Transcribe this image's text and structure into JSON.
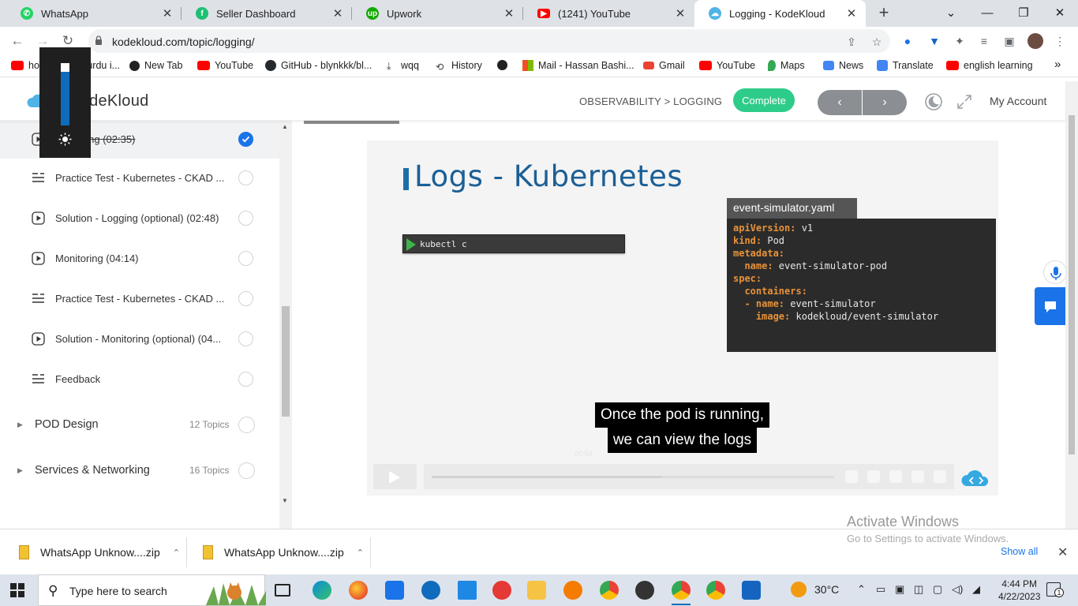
{
  "browser": {
    "tabs": [
      {
        "label": "WhatsApp",
        "icon": "whatsapp-icon",
        "color": "#25d366",
        "active": false
      },
      {
        "label": "Seller Dashboard",
        "icon": "fiverr-icon",
        "color": "#1dbf73",
        "active": false
      },
      {
        "label": "Upwork",
        "icon": "upwork-icon",
        "color": "#14a800",
        "active": false
      },
      {
        "label": "(1241) YouTube",
        "icon": "youtube-icon",
        "color": "#ff0000",
        "active": false
      },
      {
        "label": "Logging - KodeKloud",
        "icon": "kodekloud-icon",
        "color": "#4fb3e8",
        "active": true
      }
    ],
    "url": "kodekloud.com/topic/logging/",
    "bookmarks": [
      {
        "label": "how to make urdu i...",
        "color": "#ff0000"
      },
      {
        "label": "New Tab",
        "color": "#222222"
      },
      {
        "label": "YouTube",
        "color": "#ff0000"
      },
      {
        "label": "GitHub - blynkkk/bl...",
        "color": "#24292e"
      },
      {
        "label": "wqq",
        "color": "#444444"
      },
      {
        "label": "History",
        "color": "#444444"
      },
      {
        "label": "",
        "color": "#222222"
      },
      {
        "label": "Mail - Hassan Bashi...",
        "color": "#f25022"
      },
      {
        "label": "Gmail",
        "color": "#ea4335"
      },
      {
        "label": "YouTube",
        "color": "#ff0000"
      },
      {
        "label": "Maps",
        "color": "#34a853"
      },
      {
        "label": "News",
        "color": "#4285f4"
      },
      {
        "label": "Translate",
        "color": "#4285f4"
      },
      {
        "label": "english learning",
        "color": "#ff0000"
      }
    ],
    "more_bookmarks": "»"
  },
  "kk": {
    "logo_text": "KodeKloud",
    "breadcrumb": "OBSERVABILITY > LOGGING",
    "complete_label": "Complete",
    "prev": "‹",
    "next": "›",
    "account_label": "My Account",
    "accent": "#2ecc8a"
  },
  "sidebar": {
    "lessons": [
      {
        "label": "Logging (02:35)",
        "visible_label": "ging (02:35)",
        "icon": "play-circle-icon",
        "done": true,
        "current": true
      },
      {
        "label": "Practice Test - Kubernetes - CKAD ...",
        "icon": "list-icon",
        "done": false
      },
      {
        "label": "Solution - Logging (optional) (02:48)",
        "icon": "play-circle-icon",
        "done": false
      },
      {
        "label": "Monitoring (04:14)",
        "icon": "play-circle-icon",
        "done": false
      },
      {
        "label": "Practice Test - Kubernetes - CKAD ...",
        "icon": "list-icon",
        "done": false
      },
      {
        "label": "Solution - Monitoring (optional) (04...",
        "icon": "play-circle-icon",
        "done": false
      },
      {
        "label": "Feedback",
        "icon": "list-icon",
        "done": false
      }
    ],
    "sections": [
      {
        "title": "POD Design",
        "count": "12 Topics"
      },
      {
        "title": "Services & Networking",
        "count": "16 Topics"
      }
    ]
  },
  "video": {
    "slide_title": "Logs - Kubernetes",
    "terminal_command": "kubectl c",
    "yaml_filename": "event-simulator.yaml",
    "yaml_lines": [
      {
        "indent": "",
        "key": "apiVersion:",
        "value": " v1"
      },
      {
        "indent": "",
        "key": "kind:",
        "value": " Pod"
      },
      {
        "indent": "",
        "key": "metadata:",
        "value": ""
      },
      {
        "indent": "  ",
        "key": "name:",
        "value": " event-simulator-pod"
      },
      {
        "indent": "",
        "key": "spec:",
        "value": ""
      },
      {
        "indent": "  ",
        "key": "containers:",
        "value": ""
      },
      {
        "indent": "  - ",
        "key": "name:",
        "value": " event-simulator"
      },
      {
        "indent": "    ",
        "key": "image:",
        "value": " kodekloud/event-simulator"
      }
    ],
    "caption_lines": [
      "Once the pod is running,",
      "we can view the logs"
    ],
    "time": "00:54",
    "progress": 0.57
  },
  "watermark": {
    "line1": "Activate Windows",
    "line2": "Go to Settings to activate Windows."
  },
  "downloads": {
    "items": [
      {
        "name": "WhatsApp Unknow....zip"
      },
      {
        "name": "WhatsApp Unknow....zip"
      }
    ],
    "show_all": "Show all",
    "close": "✕"
  },
  "taskbar": {
    "search_placeholder": "Type here to search",
    "temperature": "30°C",
    "time": "4:44 PM",
    "date": "4/22/2023",
    "notification_count": "1"
  }
}
